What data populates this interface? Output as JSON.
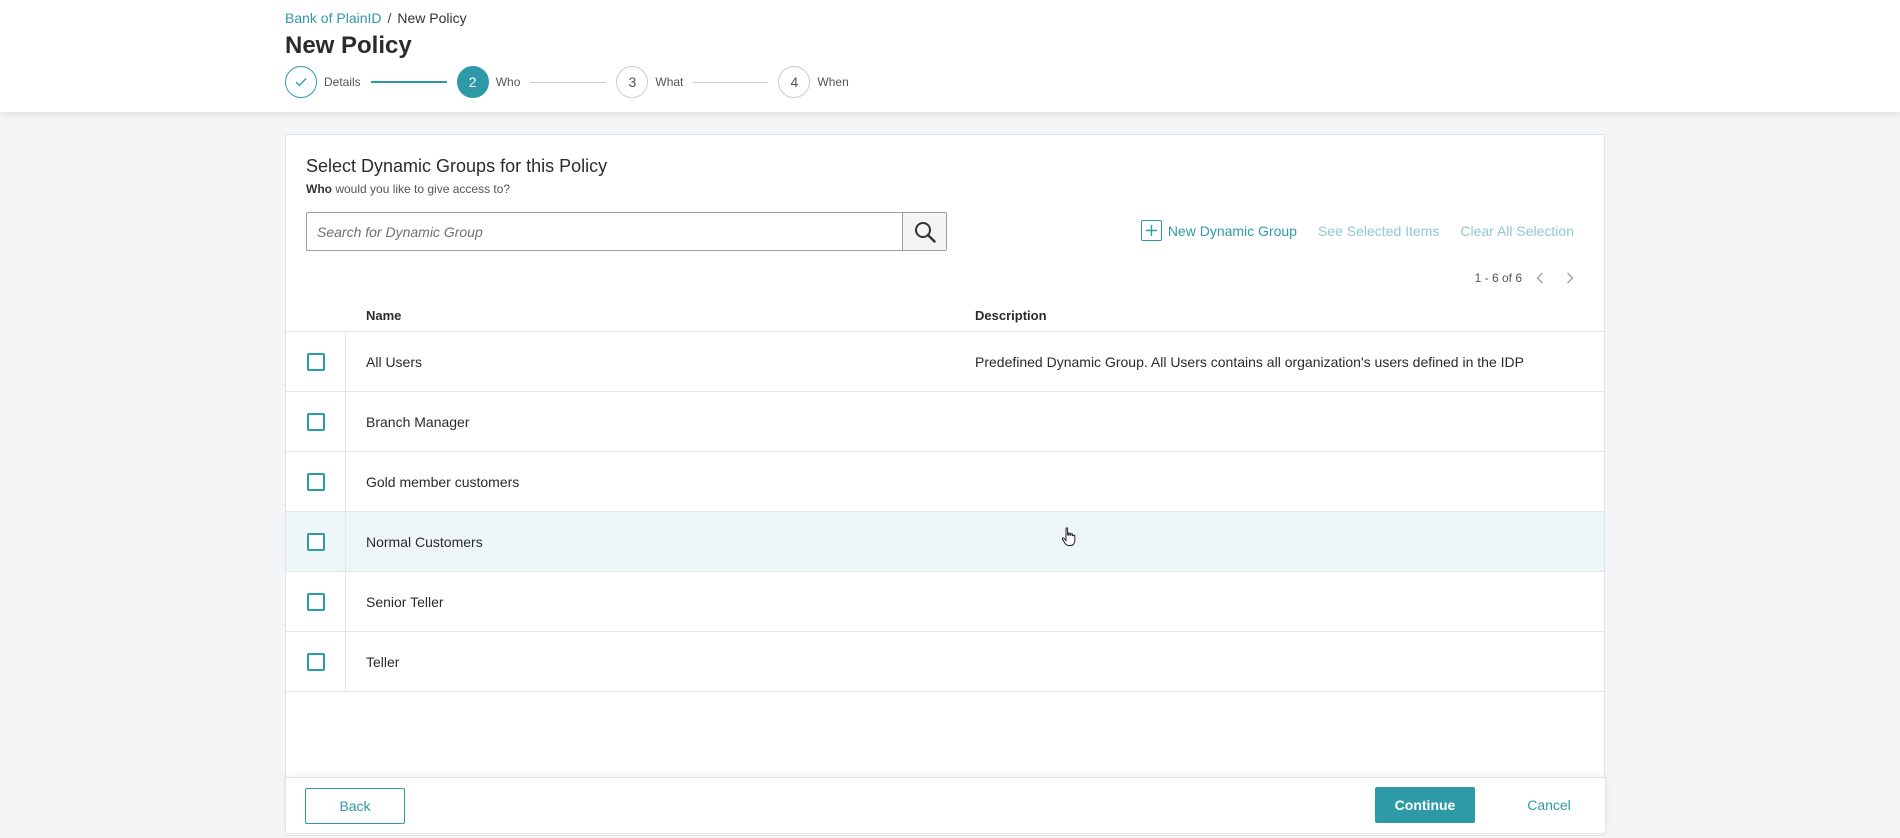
{
  "breadcrumb": {
    "root": "Bank of PlainID",
    "separator": "/",
    "current": "New Policy"
  },
  "page_title": "New Policy",
  "stepper": {
    "steps": [
      {
        "number": "",
        "label": "Details",
        "state": "done"
      },
      {
        "number": "2",
        "label": "Who",
        "state": "active"
      },
      {
        "number": "3",
        "label": "What",
        "state": "pending"
      },
      {
        "number": "4",
        "label": "When",
        "state": "pending"
      }
    ]
  },
  "panel": {
    "title": "Select Dynamic Groups for this Policy",
    "subtitle_bold": "Who",
    "subtitle_rest": " would you like to give access to?"
  },
  "search": {
    "placeholder": "Search for Dynamic Group",
    "value": ""
  },
  "actions": {
    "new_group": "New Dynamic Group",
    "see_selected": "See Selected Items",
    "clear_all": "Clear All Selection"
  },
  "pagination": {
    "range": "1 - 6 of 6"
  },
  "table": {
    "headers": {
      "name": "Name",
      "description": "Description"
    },
    "rows": [
      {
        "name": "All Users",
        "description": "Predefined Dynamic Group. All Users contains all organization's users defined in the IDP",
        "checked": false
      },
      {
        "name": "Branch Manager",
        "description": "",
        "checked": false
      },
      {
        "name": "Gold member customers",
        "description": "",
        "checked": false
      },
      {
        "name": "Normal Customers",
        "description": "",
        "checked": false
      },
      {
        "name": "Senior Teller",
        "description": "",
        "checked": false
      },
      {
        "name": "Teller",
        "description": "",
        "checked": false
      }
    ]
  },
  "footer": {
    "back": "Back",
    "continue": "Continue",
    "cancel": "Cancel"
  },
  "colors": {
    "accent": "#2e9aa8",
    "accent_muted": "#8fc9d1",
    "row_hover": "#eef7f8"
  }
}
